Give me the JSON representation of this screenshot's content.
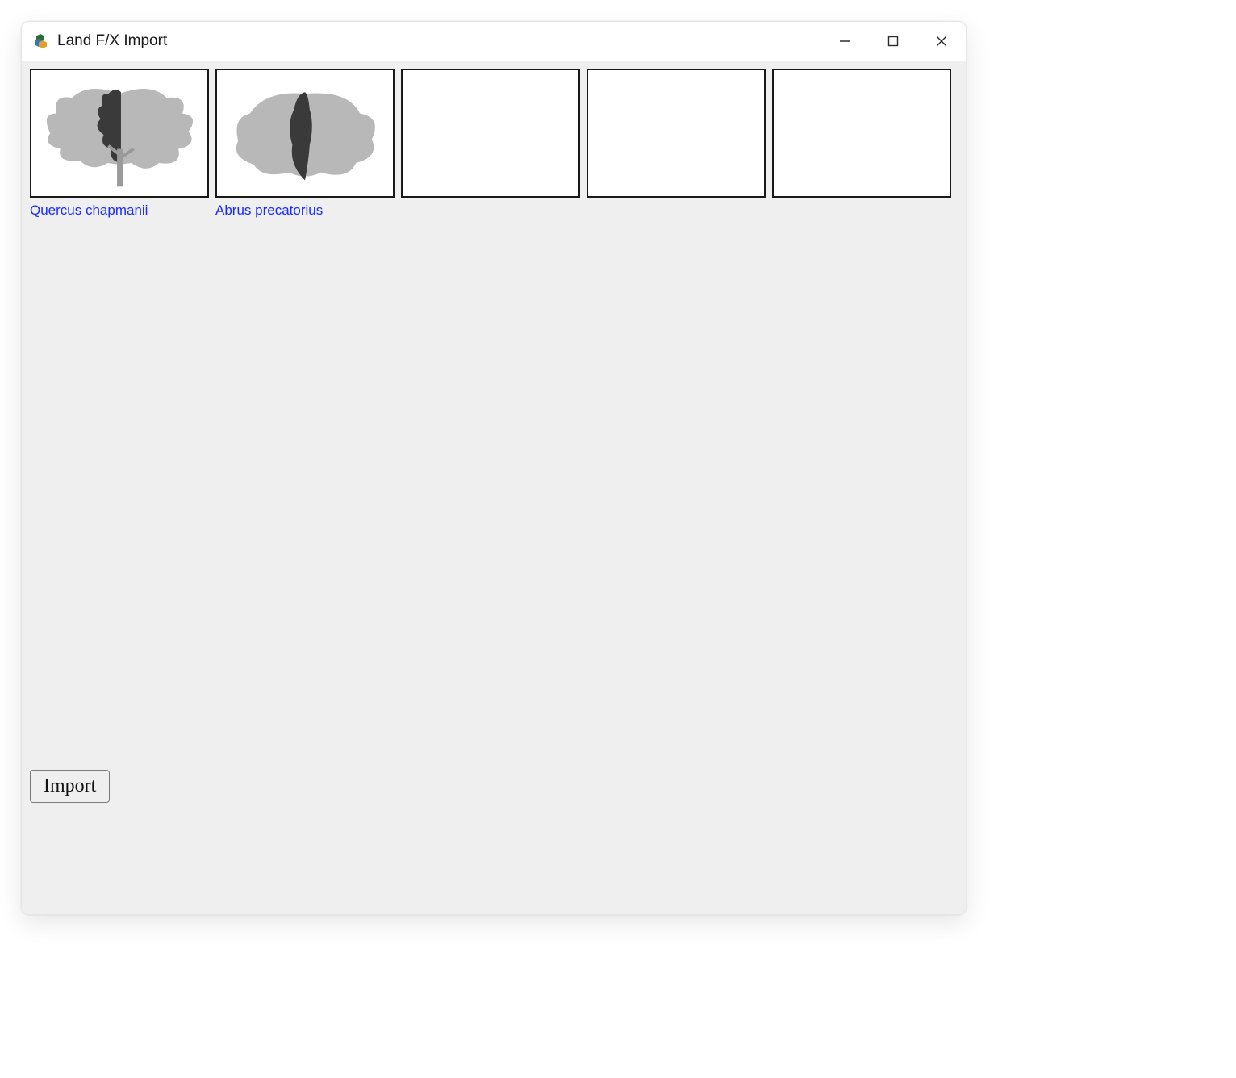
{
  "window": {
    "title": "Land F/X Import"
  },
  "slots": [
    {
      "label": "Quercus chapmanii",
      "thumb": "tree"
    },
    {
      "label": "Abrus precatorius",
      "thumb": "shrub"
    },
    {
      "label": "",
      "thumb": ""
    },
    {
      "label": "",
      "thumb": ""
    },
    {
      "label": "",
      "thumb": ""
    }
  ],
  "buttons": {
    "import": "Import"
  },
  "icons": {
    "app": "landfx-app-icon",
    "minimize": "minimize-icon",
    "maximize": "maximize-icon",
    "close": "close-icon"
  }
}
